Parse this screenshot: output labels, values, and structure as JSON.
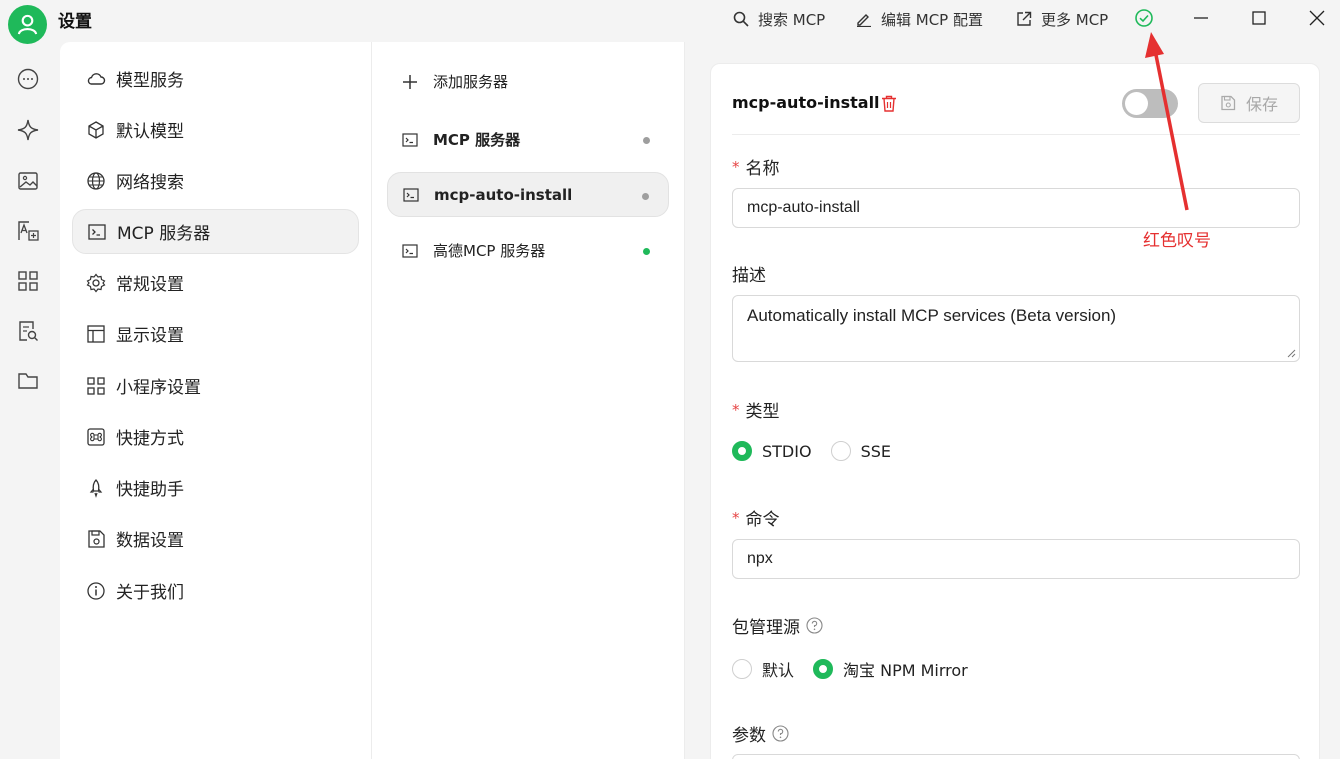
{
  "app": {
    "title": "设置"
  },
  "topbar": {
    "search_mcp": "搜索 MCP",
    "edit_mcp_config": "编辑 MCP 配置",
    "more_mcp": "更多 MCP"
  },
  "rail": {
    "icons": [
      "chat-icon",
      "sparkle-icon",
      "image-icon",
      "translate-icon",
      "apps-grid-icon",
      "document-search-icon",
      "folder-icon"
    ]
  },
  "nav": {
    "items": [
      {
        "label": "模型服务",
        "icon": "cloud-icon"
      },
      {
        "label": "默认模型",
        "icon": "cube-icon"
      },
      {
        "label": "网络搜索",
        "icon": "globe-icon"
      },
      {
        "label": "MCP 服务器",
        "icon": "terminal-icon",
        "active": true
      },
      {
        "label": "常规设置",
        "icon": "gear-icon"
      },
      {
        "label": "显示设置",
        "icon": "layout-icon"
      },
      {
        "label": "小程序设置",
        "icon": "grid-icon"
      },
      {
        "label": "快捷方式",
        "icon": "command-icon"
      },
      {
        "label": "快捷助手",
        "icon": "rocket-icon"
      },
      {
        "label": "数据设置",
        "icon": "save-icon"
      },
      {
        "label": "关于我们",
        "icon": "info-icon"
      }
    ]
  },
  "servers": {
    "add_label": "添加服务器",
    "items": [
      {
        "label": "MCP 服务器",
        "status": "inactive"
      },
      {
        "label": "mcp-auto-install",
        "status": "inactive",
        "active": true
      },
      {
        "label": "高德MCP 服务器",
        "status": "active"
      }
    ]
  },
  "detail": {
    "title": "mcp-auto-install",
    "enabled": false,
    "save_label": "保存",
    "name_label": "名称",
    "name_value": "mcp-auto-install",
    "desc_label": "描述",
    "desc_value": "Automatically install MCP services (Beta version)",
    "type_label": "类型",
    "type_options": [
      "STDIO",
      "SSE"
    ],
    "type_selected": "STDIO",
    "command_label": "命令",
    "command_value": "npx",
    "registry_label": "包管理源",
    "registry_options": [
      "默认",
      "淘宝 NPM Mirror"
    ],
    "registry_selected": "淘宝 NPM Mirror",
    "args_label": "参数"
  },
  "annotation": {
    "text": "红色叹号"
  },
  "colors": {
    "accent": "#1fb95a",
    "inactive_dot": "#9e9e9e",
    "danger": "#e53030"
  }
}
